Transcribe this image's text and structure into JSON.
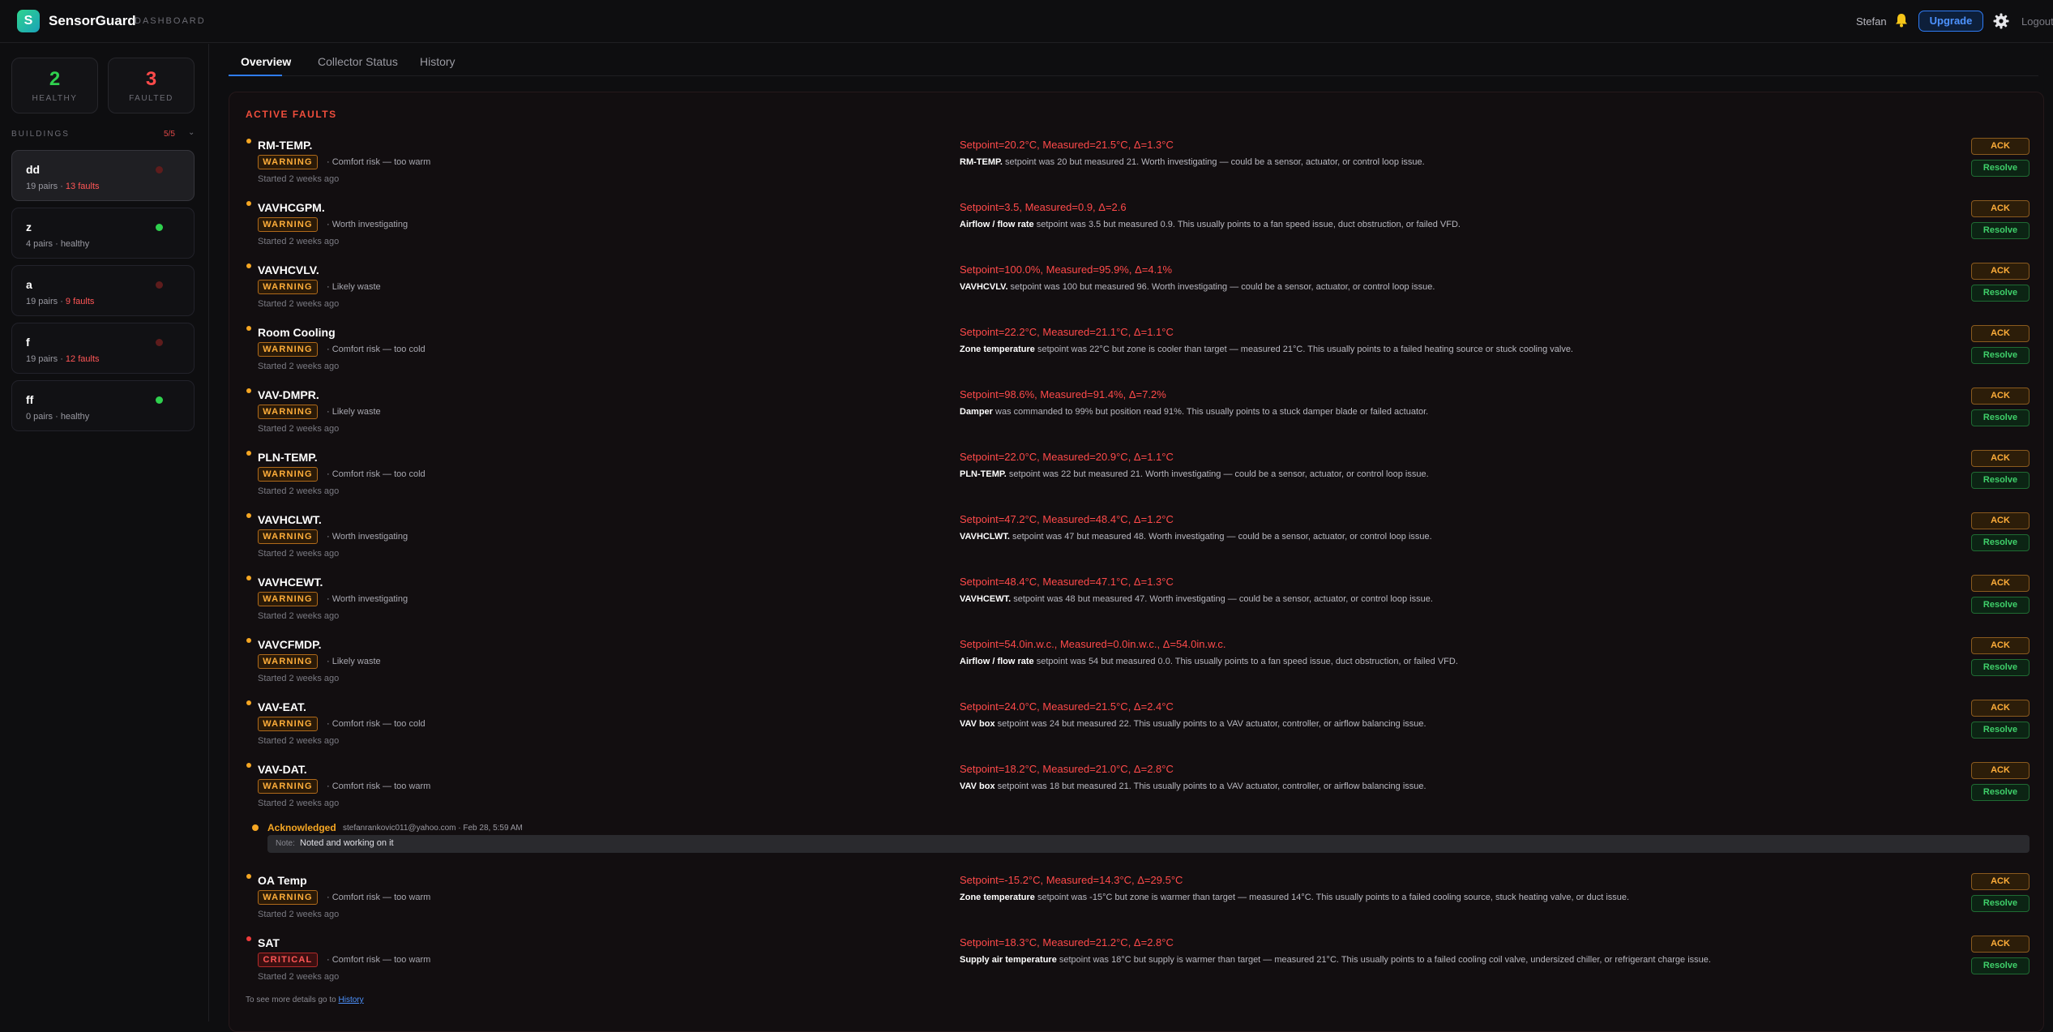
{
  "header": {
    "logo_letter": "S",
    "app_title": "SensorGuard",
    "app_subtitle": "DASHBOARD",
    "user": "Stefan",
    "upgrade_label": "Upgrade",
    "logout_label": "Logout",
    "icons": [
      "bell-icon",
      "gear-icon"
    ]
  },
  "stats": {
    "healthy": {
      "count": "2",
      "label": "HEALTHY",
      "color": "#2fd14e"
    },
    "faulted": {
      "count": "3",
      "label": "FAULTED",
      "color": "#ff4a4a"
    }
  },
  "buildings": {
    "heading": "BUILDINGS",
    "count": "5/5",
    "chevron": "⌄",
    "items": [
      {
        "name": "dd",
        "pairs": "19 pairs",
        "status": "13 faults",
        "state": "faulted"
      },
      {
        "name": "z",
        "pairs": "4 pairs",
        "status": "healthy",
        "state": "healthy"
      },
      {
        "name": "a",
        "pairs": "19 pairs",
        "status": "9 faults",
        "state": "faulted"
      },
      {
        "name": "f",
        "pairs": "19 pairs",
        "status": "12 faults",
        "state": "faulted"
      },
      {
        "name": "ff",
        "pairs": "0 pairs",
        "status": "healthy",
        "state": "healthy"
      }
    ]
  },
  "tabs": [
    {
      "label": "Overview",
      "active": true
    },
    {
      "label": "Collector Status",
      "active": false
    },
    {
      "label": "History",
      "active": false
    }
  ],
  "faults_panel": {
    "title": "ACTIVE FAULTS",
    "ack_label": "ACK",
    "resolve_label": "Resolve",
    "faults": [
      {
        "name": "RM-TEMP.",
        "severity": "WARNING",
        "impact": "· Comfort risk — too warm",
        "started": "Started 2 weeks ago",
        "reading": "Setpoint=20.2°C, Measured=21.5°C, Δ=1.3°C",
        "desc_bold": "RM-TEMP.",
        "desc": " setpoint was 20 but measured 21. Worth investigating — could be a sensor, actuator, or control loop issue."
      },
      {
        "name": "VAVHCGPM.",
        "severity": "WARNING",
        "impact": "· Worth investigating",
        "started": "Started 2 weeks ago",
        "reading": "Setpoint=3.5, Measured=0.9, Δ=2.6",
        "desc_bold": "Airflow / flow rate",
        "desc": " setpoint was 3.5 but measured 0.9. This usually points to a fan speed issue, duct obstruction, or failed VFD."
      },
      {
        "name": "VAVHCVLV.",
        "severity": "WARNING",
        "impact": "· Likely waste",
        "started": "Started 2 weeks ago",
        "reading": "Setpoint=100.0%, Measured=95.9%, Δ=4.1%",
        "desc_bold": "VAVHCVLV.",
        "desc": " setpoint was 100 but measured 96. Worth investigating — could be a sensor, actuator, or control loop issue."
      },
      {
        "name": "Room Cooling",
        "severity": "WARNING",
        "impact": "· Comfort risk — too cold",
        "started": "Started 2 weeks ago",
        "reading": "Setpoint=22.2°C, Measured=21.1°C, Δ=1.1°C",
        "desc_bold": "Zone temperature",
        "desc": " setpoint was 22°C but zone is cooler than target — measured 21°C. This usually points to a failed heating source or stuck cooling valve."
      },
      {
        "name": "VAV-DMPR.",
        "severity": "WARNING",
        "impact": "· Likely waste",
        "started": "Started 2 weeks ago",
        "reading": "Setpoint=98.6%, Measured=91.4%, Δ=7.2%",
        "desc_bold": "Damper",
        "desc": " was commanded to 99% but position read 91%. This usually points to a stuck damper blade or failed actuator."
      },
      {
        "name": "PLN-TEMP.",
        "severity": "WARNING",
        "impact": "· Comfort risk — too cold",
        "started": "Started 2 weeks ago",
        "reading": "Setpoint=22.0°C, Measured=20.9°C, Δ=1.1°C",
        "desc_bold": "PLN-TEMP.",
        "desc": " setpoint was 22 but measured 21. Worth investigating — could be a sensor, actuator, or control loop issue."
      },
      {
        "name": "VAVHCLWT.",
        "severity": "WARNING",
        "impact": "· Worth investigating",
        "started": "Started 2 weeks ago",
        "reading": "Setpoint=47.2°C, Measured=48.4°C, Δ=1.2°C",
        "desc_bold": "VAVHCLWT.",
        "desc": " setpoint was 47 but measured 48. Worth investigating — could be a sensor, actuator, or control loop issue."
      },
      {
        "name": "VAVHCEWT.",
        "severity": "WARNING",
        "impact": "· Worth investigating",
        "started": "Started 2 weeks ago",
        "reading": "Setpoint=48.4°C, Measured=47.1°C, Δ=1.3°C",
        "desc_bold": "VAVHCEWT.",
        "desc": " setpoint was 48 but measured 47. Worth investigating — could be a sensor, actuator, or control loop issue."
      },
      {
        "name": "VAVCFMDP.",
        "severity": "WARNING",
        "impact": "· Likely waste",
        "started": "Started 2 weeks ago",
        "reading": "Setpoint=54.0in.w.c., Measured=0.0in.w.c., Δ=54.0in.w.c.",
        "desc_bold": "Airflow / flow rate",
        "desc": " setpoint was 54 but measured 0.0. This usually points to a fan speed issue, duct obstruction, or failed VFD."
      },
      {
        "name": "VAV-EAT.",
        "severity": "WARNING",
        "impact": "· Comfort risk — too cold",
        "started": "Started 2 weeks ago",
        "reading": "Setpoint=24.0°C, Measured=21.5°C, Δ=2.4°C",
        "desc_bold": "VAV box",
        "desc": " setpoint was 24 but measured 22. This usually points to a VAV actuator, controller, or airflow balancing issue."
      },
      {
        "name": "VAV-DAT.",
        "severity": "WARNING",
        "impact": "· Comfort risk — too warm",
        "started": "Started 2 weeks ago",
        "reading": "Setpoint=18.2°C, Measured=21.0°C, Δ=2.8°C",
        "desc_bold": "VAV box",
        "desc": " setpoint was 18 but measured 21. This usually points to a VAV actuator, controller, or airflow balancing issue."
      },
      {
        "name": "OA Temp",
        "severity": "WARNING",
        "impact": "· Comfort risk — too warm",
        "started": "Started 2 weeks ago",
        "reading": "Setpoint=-15.2°C, Measured=14.3°C, Δ=29.5°C",
        "desc_bold": "Zone temperature",
        "desc": " setpoint was -15°C but zone is warmer than target — measured 14°C. This usually points to a failed cooling source, stuck heating valve, or duct issue."
      },
      {
        "name": "SAT",
        "severity": "CRITICAL",
        "impact": "· Comfort risk — too warm",
        "started": "Started 2 weeks ago",
        "reading": "Setpoint=18.3°C, Measured=21.2°C, Δ=2.8°C",
        "desc_bold": "Supply air temperature",
        "desc": " setpoint was 18°C but supply is warmer than target — measured 21°C. This usually points to a failed cooling coil valve, undersized chiller, or refrigerant charge issue."
      }
    ],
    "acknowledgement": {
      "title": "Acknowledged",
      "meta": "stefanrankovic011@yahoo.com · Feb 28, 5:59 AM",
      "note_label": "Note:",
      "note_text": "Noted and working on it"
    },
    "footer_prefix": "To see more details go to",
    "footer_link": "History"
  }
}
